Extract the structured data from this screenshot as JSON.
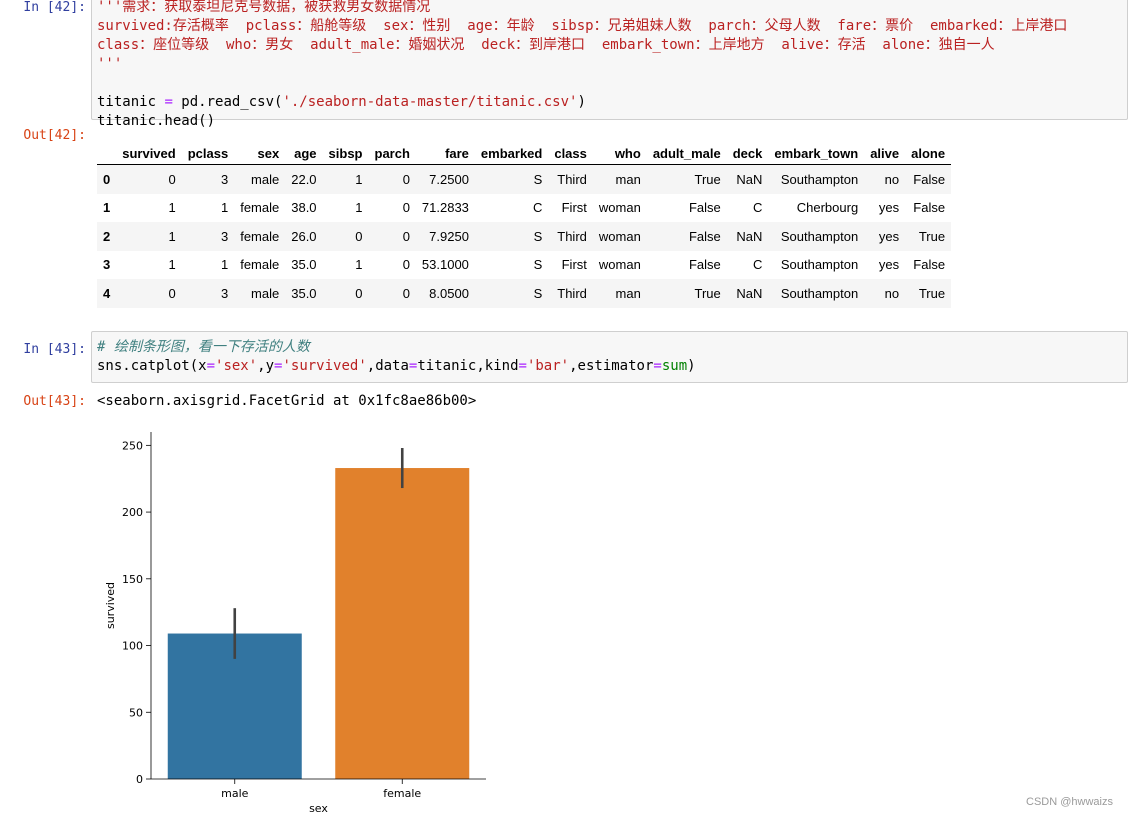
{
  "cells": [
    {
      "in_prompt": "In  [42]:",
      "code_lines": [
        [
          {
            "t": "'''需求：获取泰坦尼克号数据，被获救男女数据情况",
            "c": "s-str"
          }
        ],
        [
          {
            "t": "survived:存活概率  pclass：船舱等级  sex：性别  age：年龄  sibsp：兄弟姐妹人数  parch：父母人数  fare：票价  embarked：上岸港口",
            "c": "s-str"
          }
        ],
        [
          {
            "t": "class：座位等级  who：男女  adult_male：婚姻状况  deck：到岸港口  embark_town：上岸地方  alive：存活  alone：独自一人",
            "c": "s-str"
          }
        ],
        [
          {
            "t": "'''",
            "c": "s-str"
          }
        ],
        [
          {
            "t": "",
            "c": ""
          }
        ],
        [
          {
            "t": "titanic ",
            "c": ""
          },
          {
            "t": "=",
            "c": "s-op"
          },
          {
            "t": " pd.read_csv(",
            "c": ""
          },
          {
            "t": "'./seaborn-data-master/titanic.csv'",
            "c": "s-str"
          },
          {
            "t": ")",
            "c": ""
          }
        ],
        [
          {
            "t": "titanic.head()",
            "c": ""
          }
        ]
      ],
      "out_prompt": "Out[42]:"
    },
    {
      "in_prompt": "In  [43]:",
      "code_lines": [
        [
          {
            "t": "# 绘制条形图，看一下存活的人数",
            "c": "s-cmt"
          }
        ],
        [
          {
            "t": "sns.catplot(x",
            "c": ""
          },
          {
            "t": "=",
            "c": "s-op"
          },
          {
            "t": "'sex'",
            "c": "s-str"
          },
          {
            "t": ",y",
            "c": ""
          },
          {
            "t": "=",
            "c": "s-op"
          },
          {
            "t": "'survived'",
            "c": "s-str"
          },
          {
            "t": ",data",
            "c": ""
          },
          {
            "t": "=",
            "c": "s-op"
          },
          {
            "t": "titanic,kind",
            "c": ""
          },
          {
            "t": "=",
            "c": "s-op"
          },
          {
            "t": "'bar'",
            "c": "s-str"
          },
          {
            "t": ",estimator",
            "c": ""
          },
          {
            "t": "=",
            "c": "s-op"
          },
          {
            "t": "sum",
            "c": "s-bi"
          },
          {
            "t": ")",
            "c": ""
          }
        ]
      ],
      "out_prompt": "Out[43]:",
      "out_text": "<seaborn.axisgrid.FacetGrid at 0x1fc8ae86b00>"
    }
  ],
  "dataframe": {
    "columns": [
      "",
      "survived",
      "pclass",
      "sex",
      "age",
      "sibsp",
      "parch",
      "fare",
      "embarked",
      "class",
      "who",
      "adult_male",
      "deck",
      "embark_town",
      "alive",
      "alone"
    ],
    "rows": [
      [
        "0",
        "0",
        "3",
        "male",
        "22.0",
        "1",
        "0",
        "7.2500",
        "S",
        "Third",
        "man",
        "True",
        "NaN",
        "Southampton",
        "no",
        "False"
      ],
      [
        "1",
        "1",
        "1",
        "female",
        "38.0",
        "1",
        "0",
        "71.2833",
        "C",
        "First",
        "woman",
        "False",
        "C",
        "Cherbourg",
        "yes",
        "False"
      ],
      [
        "2",
        "1",
        "3",
        "female",
        "26.0",
        "0",
        "0",
        "7.9250",
        "S",
        "Third",
        "woman",
        "False",
        "NaN",
        "Southampton",
        "yes",
        "True"
      ],
      [
        "3",
        "1",
        "1",
        "female",
        "35.0",
        "1",
        "0",
        "53.1000",
        "S",
        "First",
        "woman",
        "False",
        "C",
        "Southampton",
        "yes",
        "False"
      ],
      [
        "4",
        "0",
        "3",
        "male",
        "35.0",
        "0",
        "0",
        "8.0500",
        "S",
        "Third",
        "man",
        "True",
        "NaN",
        "Southampton",
        "no",
        "True"
      ]
    ]
  },
  "chart_data": {
    "type": "bar",
    "categories": [
      "male",
      "female"
    ],
    "values": [
      109,
      233
    ],
    "error_bars": [
      [
        90,
        128
      ],
      [
        218,
        248
      ]
    ],
    "colors": [
      "#3274a1",
      "#e1812c"
    ],
    "xlabel": "sex",
    "ylabel": "survived",
    "ylim": [
      0,
      260
    ],
    "yticks": [
      0,
      50,
      100,
      150,
      200,
      250
    ],
    "grid": false
  },
  "watermark": "CSDN @hwwaizs"
}
